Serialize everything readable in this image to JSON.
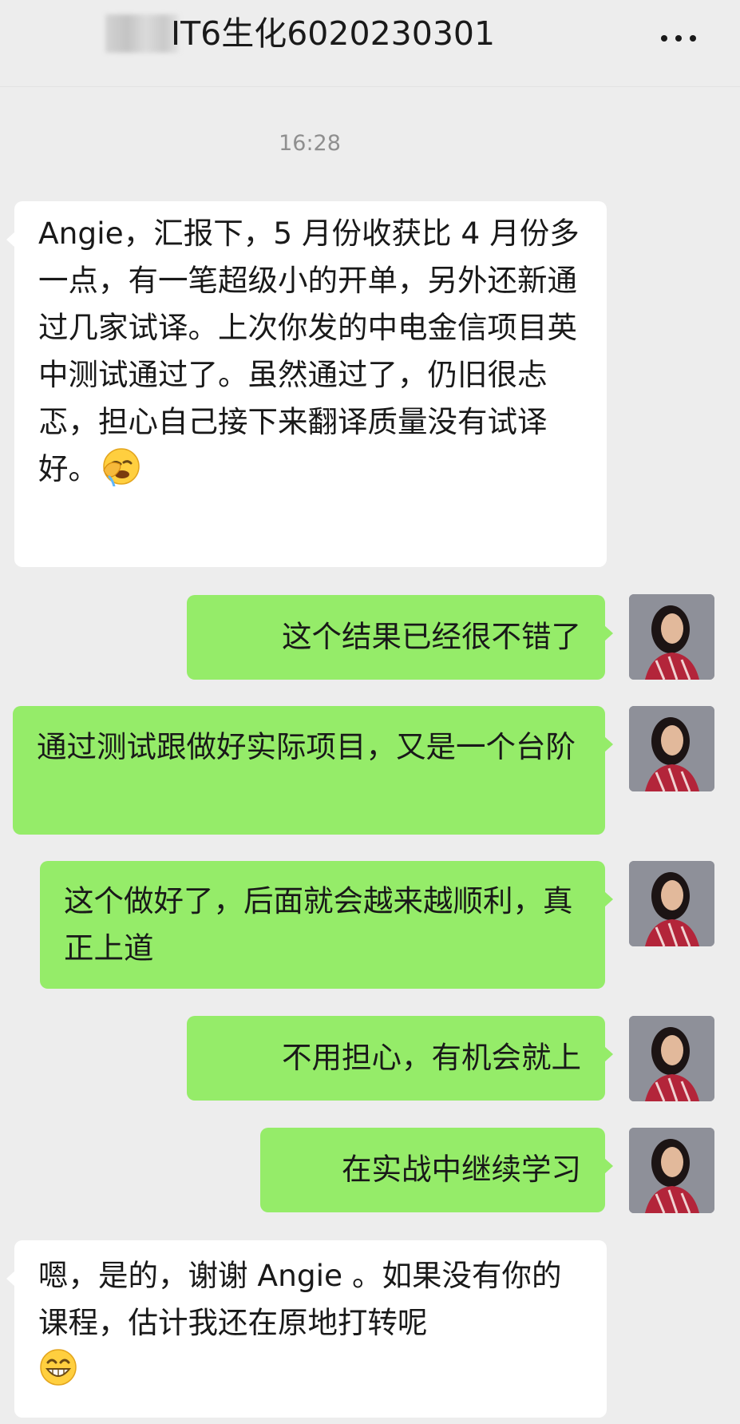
{
  "header": {
    "title": "IT6生化6020230301",
    "more_icon": "more-icon"
  },
  "timestamp": "16:28",
  "messages": [
    {
      "side": "incoming",
      "text": "Angie，汇报下，5 月份收获比 4 月份多一点，有一笔超级小的开单，另外还新通过几家试译。上次你发的中电金信项目英中测试通过了。虽然通过了，仍旧很忐忑，担心自己接下来翻译质量没有试译好。",
      "emoji": "facepalm-emoji"
    },
    {
      "side": "outgoing",
      "text": "这个结果已经很不错了"
    },
    {
      "side": "outgoing",
      "text": "通过测试跟做好实际项目，又是一个台阶"
    },
    {
      "side": "outgoing",
      "text": "这个做好了，后面就会越来越顺利，真正上道"
    },
    {
      "side": "outgoing",
      "text": "不用担心，有机会就上"
    },
    {
      "side": "outgoing",
      "text": "在实战中继续学习"
    },
    {
      "side": "incoming",
      "text": "嗯，是的，谢谢 Angie 。如果没有你的课程，估计我还在原地打转呢",
      "emoji": "grin-emoji"
    }
  ],
  "colors": {
    "background": "#ededed",
    "incoming_bubble": "#ffffff",
    "outgoing_bubble": "#95ec69",
    "timestamp": "#8f8f8f"
  }
}
